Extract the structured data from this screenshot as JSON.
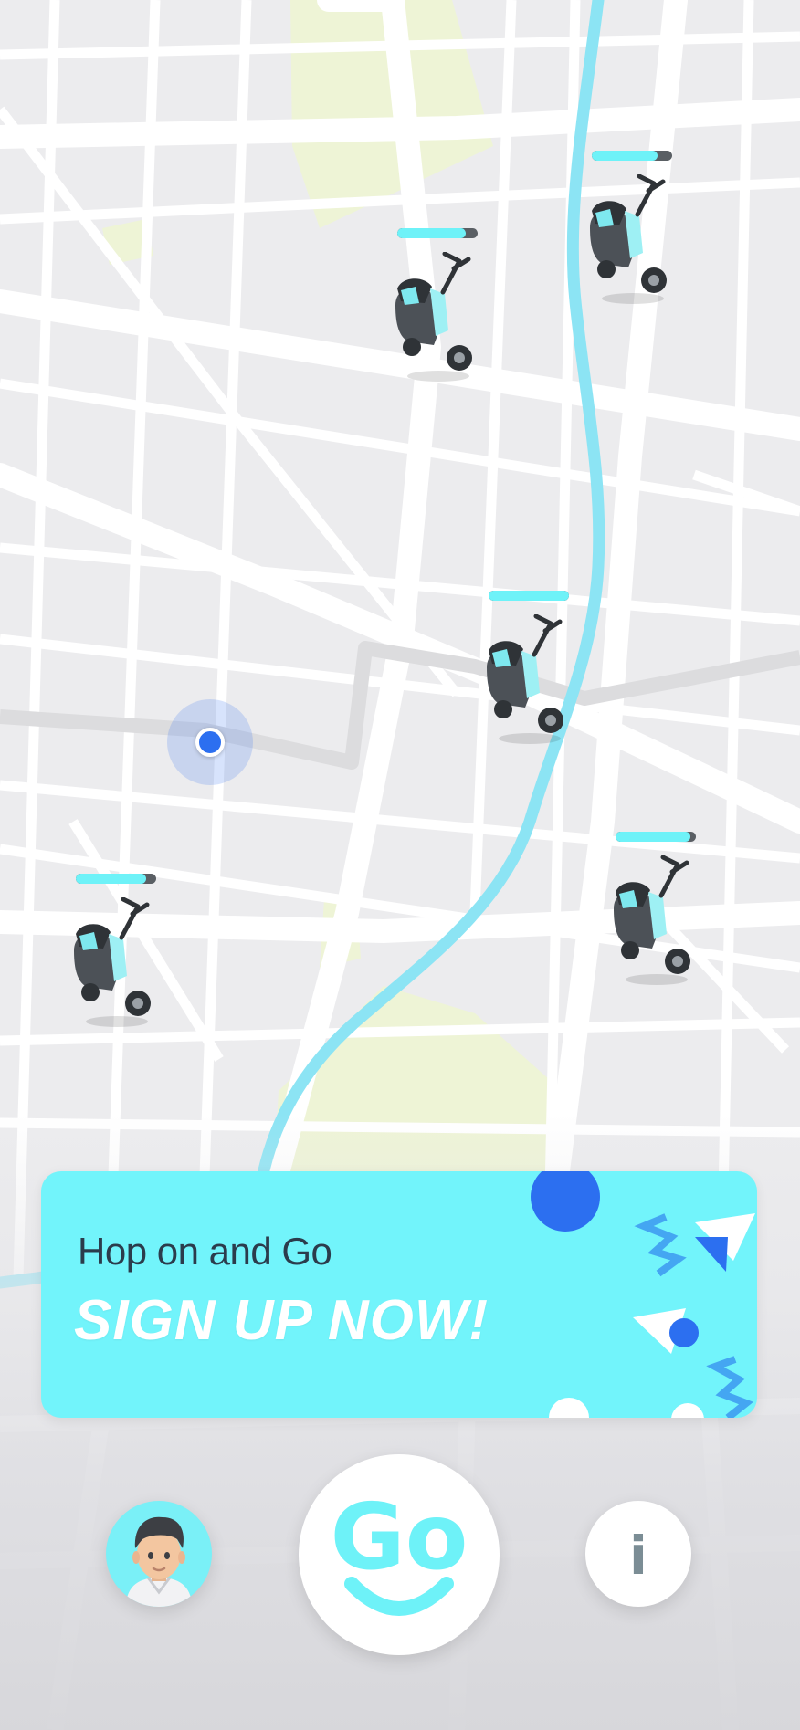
{
  "promo": {
    "line1": "Hop on and Go",
    "line2": "SIGN UP NOW!"
  },
  "scooters": [
    {
      "id": "scooter-1",
      "battery": 0.85
    },
    {
      "id": "scooter-2",
      "battery": 0.82
    },
    {
      "id": "scooter-3",
      "battery": 1.0
    },
    {
      "id": "scooter-4",
      "battery": 0.88
    },
    {
      "id": "scooter-5",
      "battery": 0.93
    }
  ],
  "buttons": {
    "go_label": "Go",
    "info_label": "i"
  },
  "colors": {
    "accent": "#6ef2f8",
    "promo_background": "#72f4fb",
    "location_dot": "#2c6ff0",
    "promo_text": "#2b3c4c",
    "road": "#ffffff",
    "river": "#8ce4f4",
    "park": "#eef4d6"
  },
  "icons": {
    "profile": "avatar-icon",
    "go": "go-logo-icon",
    "info": "info-icon",
    "scooter": "scooter-icon",
    "location": "location-dot-icon"
  }
}
